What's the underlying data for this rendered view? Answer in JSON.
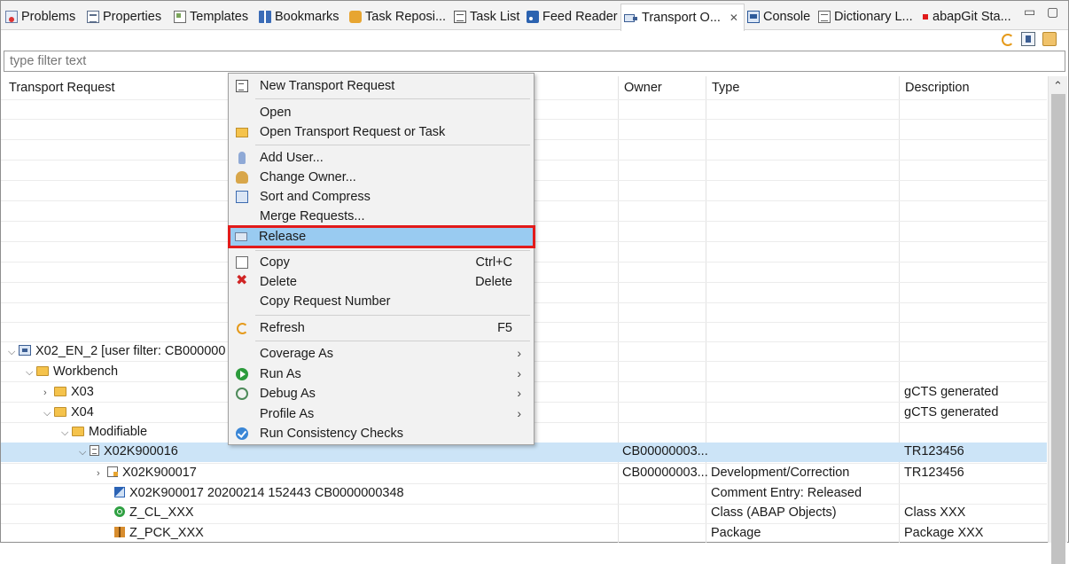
{
  "tabs": [
    {
      "label": "Problems",
      "icon": "problems-icon"
    },
    {
      "label": "Properties",
      "icon": "properties-icon"
    },
    {
      "label": "Templates",
      "icon": "templates-icon"
    },
    {
      "label": "Bookmarks",
      "icon": "bookmarks-icon"
    },
    {
      "label": "Task Reposi...",
      "icon": "task-repository-icon"
    },
    {
      "label": "Task List",
      "icon": "task-list-icon"
    },
    {
      "label": "Feed Reader",
      "icon": "feed-reader-icon"
    },
    {
      "label": "Transport O...",
      "icon": "transport-organizer-icon",
      "active": true,
      "close": "✕"
    },
    {
      "label": "Console",
      "icon": "console-icon"
    },
    {
      "label": "Dictionary L...",
      "icon": "dictionary-log-icon"
    },
    {
      "label": "abapGit Sta...",
      "icon": "abapgit-staging-icon"
    }
  ],
  "window_controls": {
    "minimize": "▭",
    "maximize": "▢"
  },
  "filter": {
    "placeholder": "type filter text"
  },
  "table": {
    "headers": {
      "request": "Transport Request",
      "owner": "Owner",
      "type": "Type",
      "description": "Description"
    },
    "rows": [
      {
        "twisty": "⌵",
        "icon": "system-icon",
        "label": "X02_EN_2 [user filter: CB000000",
        "owner": "",
        "type": "",
        "description": ""
      },
      {
        "twisty": "⌵",
        "icon": "folder-icon",
        "label": "Workbench",
        "owner": "",
        "type": "",
        "description": ""
      },
      {
        "twisty": "›",
        "icon": "folder-icon",
        "label": "X03",
        "owner": "",
        "type": "",
        "description": "gCTS generated"
      },
      {
        "twisty": "⌵",
        "icon": "folder-icon",
        "label": "X04",
        "owner": "",
        "type": "",
        "description": "gCTS generated"
      },
      {
        "twisty": "⌵",
        "icon": "folder-icon",
        "label": "Modifiable",
        "owner": "",
        "type": "",
        "description": ""
      },
      {
        "twisty": "⌵",
        "icon": "request-icon",
        "label": "X02K900016",
        "owner": "CB00000003...",
        "type": "",
        "description": "TR123456",
        "selected": true
      },
      {
        "twisty": "›",
        "icon": "task-icon",
        "label": "X02K900017",
        "owner": "CB00000003...",
        "type": "Development/Correction",
        "description": "TR123456"
      },
      {
        "twisty": "",
        "icon": "comment-entry-icon",
        "label": "X02K900017 20200214 152443 CB0000000348",
        "owner": "",
        "type": "Comment Entry: Released",
        "description": ""
      },
      {
        "twisty": "",
        "icon": "class-icon",
        "label": "Z_CL_XXX",
        "owner": "",
        "type": "Class (ABAP Objects)",
        "description": "Class XXX"
      },
      {
        "twisty": "",
        "icon": "package-icon",
        "label": "Z_PCK_XXX",
        "owner": "",
        "type": "Package",
        "description": "Package XXX"
      }
    ]
  },
  "context_menu": {
    "items": [
      {
        "label": "New Transport Request",
        "icon": "new-request-icon"
      },
      {
        "label": "Open",
        "icon": ""
      },
      {
        "label": "Open Transport Request or Task",
        "icon": "open-request-icon"
      },
      {
        "label": "Add User...",
        "icon": "add-user-icon"
      },
      {
        "label": "Change Owner...",
        "icon": "change-owner-icon"
      },
      {
        "label": "Sort and Compress",
        "icon": "sort-compress-icon"
      },
      {
        "label": "Merge Requests...",
        "icon": ""
      },
      {
        "label": "Release",
        "icon": "release-icon",
        "highlighted": true
      },
      {
        "label": "Copy",
        "icon": "copy-icon",
        "shortcut": "Ctrl+C"
      },
      {
        "label": "Delete",
        "icon": "delete-icon",
        "shortcut": "Delete"
      },
      {
        "label": "Copy Request Number",
        "icon": ""
      },
      {
        "label": "Refresh",
        "icon": "refresh-icon",
        "shortcut": "F5"
      },
      {
        "label": "Coverage As",
        "icon": "",
        "submenu": "›"
      },
      {
        "label": "Run As",
        "icon": "run-icon",
        "submenu": "›"
      },
      {
        "label": "Debug As",
        "icon": "debug-icon",
        "submenu": "›"
      },
      {
        "label": "Profile As",
        "icon": "",
        "submenu": "›"
      },
      {
        "label": "Run Consistency Checks",
        "icon": "consistency-check-icon"
      }
    ]
  },
  "colors": {
    "selection": "#cce4f7",
    "menu_highlight": "#99cbf1",
    "callout_border": "#e21b1b"
  }
}
